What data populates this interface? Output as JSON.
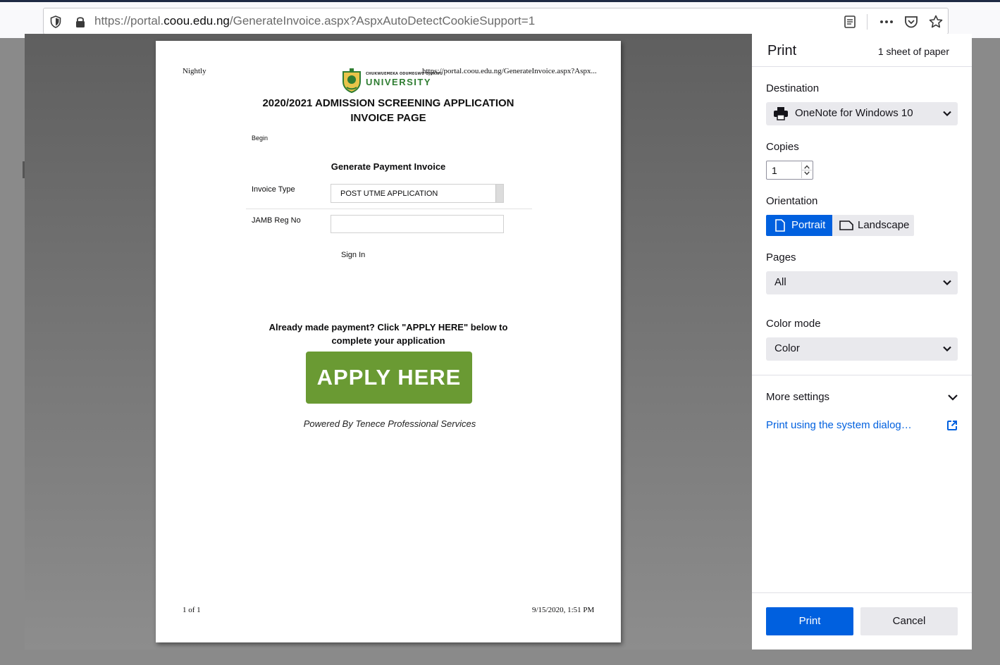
{
  "browser": {
    "url_prefix": "https://portal.",
    "url_domain": "coou.edu.ng",
    "url_path": "/GenerateInvoice.aspx?AspxAutoDetectCookieSupport=1"
  },
  "page": {
    "header_left": "Nightly",
    "header_right": "https://portal.coou.edu.ng/GenerateInvoice.aspx?Aspx...",
    "footer_left": "1 of 1",
    "footer_right": "9/15/2020, 1:51 PM",
    "logo_small": "CHUKWUEMEKA ODUMEGWU OJUKWU",
    "logo_big": "UNIVERSITY",
    "title_line1": "2020/2021 ADMISSION SCREENING APPLICATION",
    "title_line2": "INVOICE PAGE",
    "begin": "Begin",
    "generate_heading": "Generate Payment Invoice",
    "invoice_type_label": "Invoice Type",
    "invoice_type_value": "POST UTME APPLICATION",
    "jamb_label": "JAMB Reg No",
    "jamb_value": "",
    "sign_in": "Sign In",
    "already_line1": "Already made payment? Click \"APPLY HERE\" below to",
    "already_line2": "complete your application",
    "apply_button": "APPLY HERE",
    "powered_by": "Powered By Tenece Professional Services"
  },
  "print_panel": {
    "title": "Print",
    "sheets": "1 sheet of paper",
    "destination_label": "Destination",
    "destination_value": "OneNote for Windows 10",
    "copies_label": "Copies",
    "copies_value": "1",
    "orientation_label": "Orientation",
    "portrait": "Portrait",
    "landscape": "Landscape",
    "pages_label": "Pages",
    "pages_value": "All",
    "color_label": "Color mode",
    "color_value": "Color",
    "more_settings": "More settings",
    "system_dialog": "Print using the system dialog…",
    "print_button": "Print",
    "cancel_button": "Cancel"
  },
  "colors": {
    "accent": "#0060df",
    "apply_green": "#6a9a33",
    "logo_green": "#2f7d32"
  }
}
